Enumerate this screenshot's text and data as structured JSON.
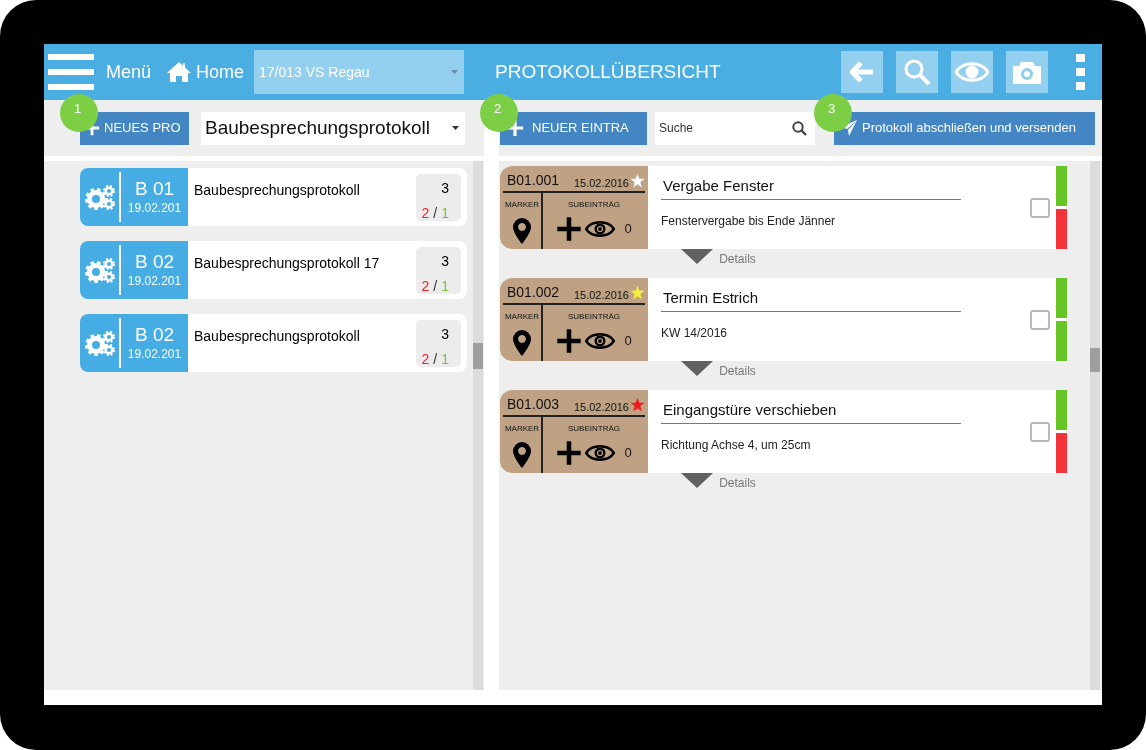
{
  "top_bar": {
    "menu_label": "Menü",
    "home_label": "Home",
    "project": "17/013 VS Regau",
    "title": "PROTOKOLLÜBERSICHT"
  },
  "left_toolbar": {
    "new_button": {
      "label": "NEUES PRO",
      "step": "1"
    },
    "type_select": "Baubesprechungsprotokoll"
  },
  "protocols": [
    {
      "code": "B 01",
      "date": "19.02.201",
      "title": "Baubesprechungsprotokoll",
      "total": "3",
      "open": "2",
      "separator": "/",
      "done": "1"
    },
    {
      "code": "B 02",
      "date": "19.02.201",
      "title": "Baubesprechungsprotokoll 17",
      "total": "3",
      "open": "2",
      "separator": "/",
      "done": "1"
    },
    {
      "code": "B 02",
      "date": "19.02.201",
      "title": "Baubesprechungsprotokoll",
      "total": "3",
      "open": "2",
      "separator": "/",
      "done": "1"
    }
  ],
  "right_toolbar": {
    "new_button": {
      "label": "NEUER EINTRA",
      "step": "2"
    },
    "search": {
      "placeholder": "Suche"
    },
    "send_button": {
      "label": "Protokoll abschließen und versenden",
      "step": "3"
    }
  },
  "entries": [
    {
      "code": "B01.001",
      "date": "15.02.2016",
      "color": "#ffffff",
      "marker_label": "MARKER",
      "sub_label": "SUBEINTRÄG",
      "sub_count": "0",
      "title": "Vergabe Fenster",
      "text": "Fenstervergabe bis Ende Jänner",
      "checked": false,
      "status": [
        {
          "color": "#66c424"
        },
        {
          "color": "#f2333a"
        }
      ],
      "details": "Details"
    },
    {
      "code": "B01.002",
      "date": "15.02.2016",
      "color": "#f5f03a",
      "marker_label": "MARKER",
      "sub_label": "SUBEINTRÄG",
      "sub_count": "0",
      "title": "Termin Estrich",
      "text": "KW 14/2016",
      "checked": false,
      "status": [
        {
          "color": "#66c424"
        },
        {
          "color": "#66c424"
        }
      ],
      "details": "Details"
    },
    {
      "code": "B01.003",
      "date": "15.02.2016",
      "color": "#f21c1c",
      "marker_label": "MARKER",
      "sub_label": "SUBEINTRÄG",
      "sub_count": "0",
      "title": "Eingangstüre verschieben",
      "text": "Richtung Achse 4, um 25cm",
      "checked": false,
      "status": [
        {
          "color": "#66c424"
        },
        {
          "color": "#f2333a"
        }
      ],
      "details": "Details"
    }
  ]
}
